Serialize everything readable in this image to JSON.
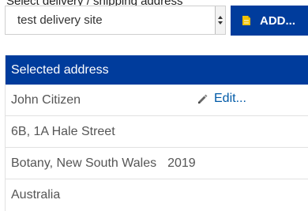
{
  "delivery": {
    "cut_label": "Select delivery / shipping address",
    "select_value": "test delivery site",
    "add_label": "ADD...",
    "icons": {
      "add": "note-add-icon",
      "select": "select-arrows-icon"
    },
    "accent_color": "#003c9c"
  },
  "selected_address": {
    "title": "Selected address",
    "name": "John Citizen",
    "edit_label": "Edit...",
    "street": "6B, 1A Hale Street",
    "suburb_state": "Botany, New South Wales",
    "postcode": "2019",
    "country": "Australia",
    "icons": {
      "edit": "pencil-icon"
    }
  }
}
